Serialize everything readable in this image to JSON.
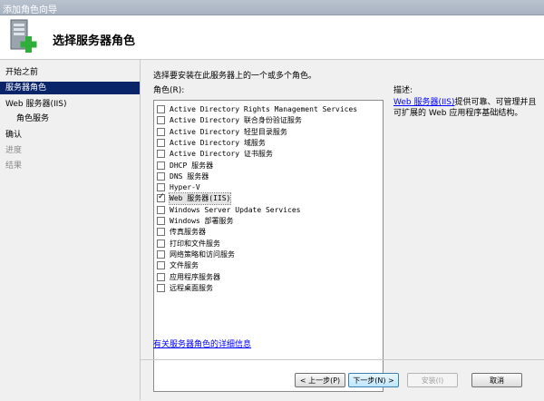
{
  "window": {
    "title": "添加角色向导"
  },
  "header": {
    "title": "选择服务器角色"
  },
  "nav": [
    {
      "label": "开始之前",
      "state": "normal",
      "sub": false
    },
    {
      "label": "服务器角色",
      "state": "active",
      "sub": false
    },
    {
      "label": "Web 服务器(IIS)",
      "state": "normal",
      "sub": false
    },
    {
      "label": "角色服务",
      "state": "normal",
      "sub": true
    },
    {
      "label": "确认",
      "state": "normal",
      "sub": false
    },
    {
      "label": "进度",
      "state": "disabled",
      "sub": false
    },
    {
      "label": "结果",
      "state": "disabled",
      "sub": false
    }
  ],
  "main": {
    "instruction": "选择要安装在此服务器上的一个或多个角色。",
    "roles_label": "角色(R):",
    "roles": [
      {
        "label": "Active Directory Rights Management Services",
        "checked": false
      },
      {
        "label": "Active Directory 联合身份验证服务",
        "checked": false
      },
      {
        "label": "Active Directory 轻型目录服务",
        "checked": false
      },
      {
        "label": "Active Directory 域服务",
        "checked": false
      },
      {
        "label": "Active Directory 证书服务",
        "checked": false
      },
      {
        "label": "DHCP 服务器",
        "checked": false
      },
      {
        "label": "DNS 服务器",
        "checked": false
      },
      {
        "label": "Hyper-V",
        "checked": false
      },
      {
        "label": "Web 服务器(IIS)",
        "checked": true
      },
      {
        "label": "Windows Server Update Services",
        "checked": false
      },
      {
        "label": "Windows 部署服务",
        "checked": false
      },
      {
        "label": "传真服务器",
        "checked": false
      },
      {
        "label": "打印和文件服务",
        "checked": false
      },
      {
        "label": "网络策略和访问服务",
        "checked": false
      },
      {
        "label": "文件服务",
        "checked": false
      },
      {
        "label": "应用程序服务器",
        "checked": false
      },
      {
        "label": "远程桌面服务",
        "checked": false
      }
    ],
    "more_info_link": "有关服务器角色的详细信息",
    "description_label": "描述:",
    "description_link": "Web 服务器(IIS)",
    "description_text": "提供可靠、可管理并且可扩展的 Web 应用程序基础结构。"
  },
  "buttons": {
    "previous": "< 上一步(P)",
    "next": "下一步(N) >",
    "install": "安装(I)",
    "cancel": "取消"
  }
}
